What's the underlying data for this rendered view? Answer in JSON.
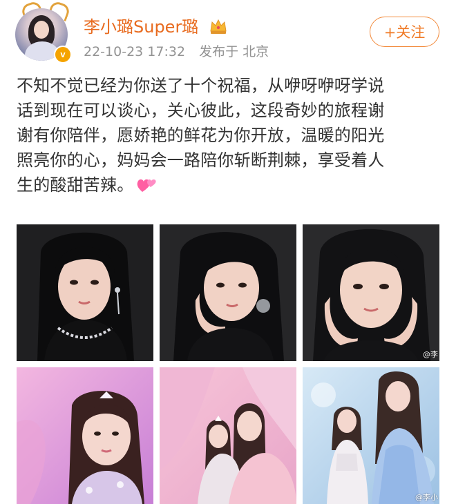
{
  "user": {
    "name": "李小璐Super璐",
    "avatar_icon": "avatar-image",
    "verified_icon": "verified-badge-icon",
    "badge_text": "v",
    "crown_icon": "crown-icon"
  },
  "post_meta": {
    "timestamp": "22-10-23 17:32",
    "location": "发布于 北京"
  },
  "follow_button": {
    "label": "+关注"
  },
  "post_text_lines": [
    "不知不觉已经为你送了十个祝福，从咿呀咿呀学说",
    "话到现在可以谈心，关心彼此，这段奇妙的旅程谢",
    "谢有你陪伴，愿娇艳的鲜花为你开放，温暖的阳光",
    "照亮你的心，妈妈会一路陪你斩断荆棘，享受着人",
    "生的酸甜苦辣。"
  ],
  "post_emoji_icon": "two-hearts-icon",
  "photos": [
    {
      "name": "photo-1",
      "theme": "dark"
    },
    {
      "name": "photo-2",
      "theme": "dark"
    },
    {
      "name": "photo-3",
      "theme": "dark"
    },
    {
      "name": "photo-4",
      "theme": "pink"
    },
    {
      "name": "photo-5",
      "theme": "pink"
    },
    {
      "name": "photo-6",
      "theme": "blue"
    }
  ],
  "watermarks": {
    "photo_3": "@李",
    "photo_6": "@李小"
  },
  "colors": {
    "username": "#e86b1f",
    "follow_accent": "#f07a26",
    "meta_text": "#939393",
    "body_text": "#333333"
  }
}
